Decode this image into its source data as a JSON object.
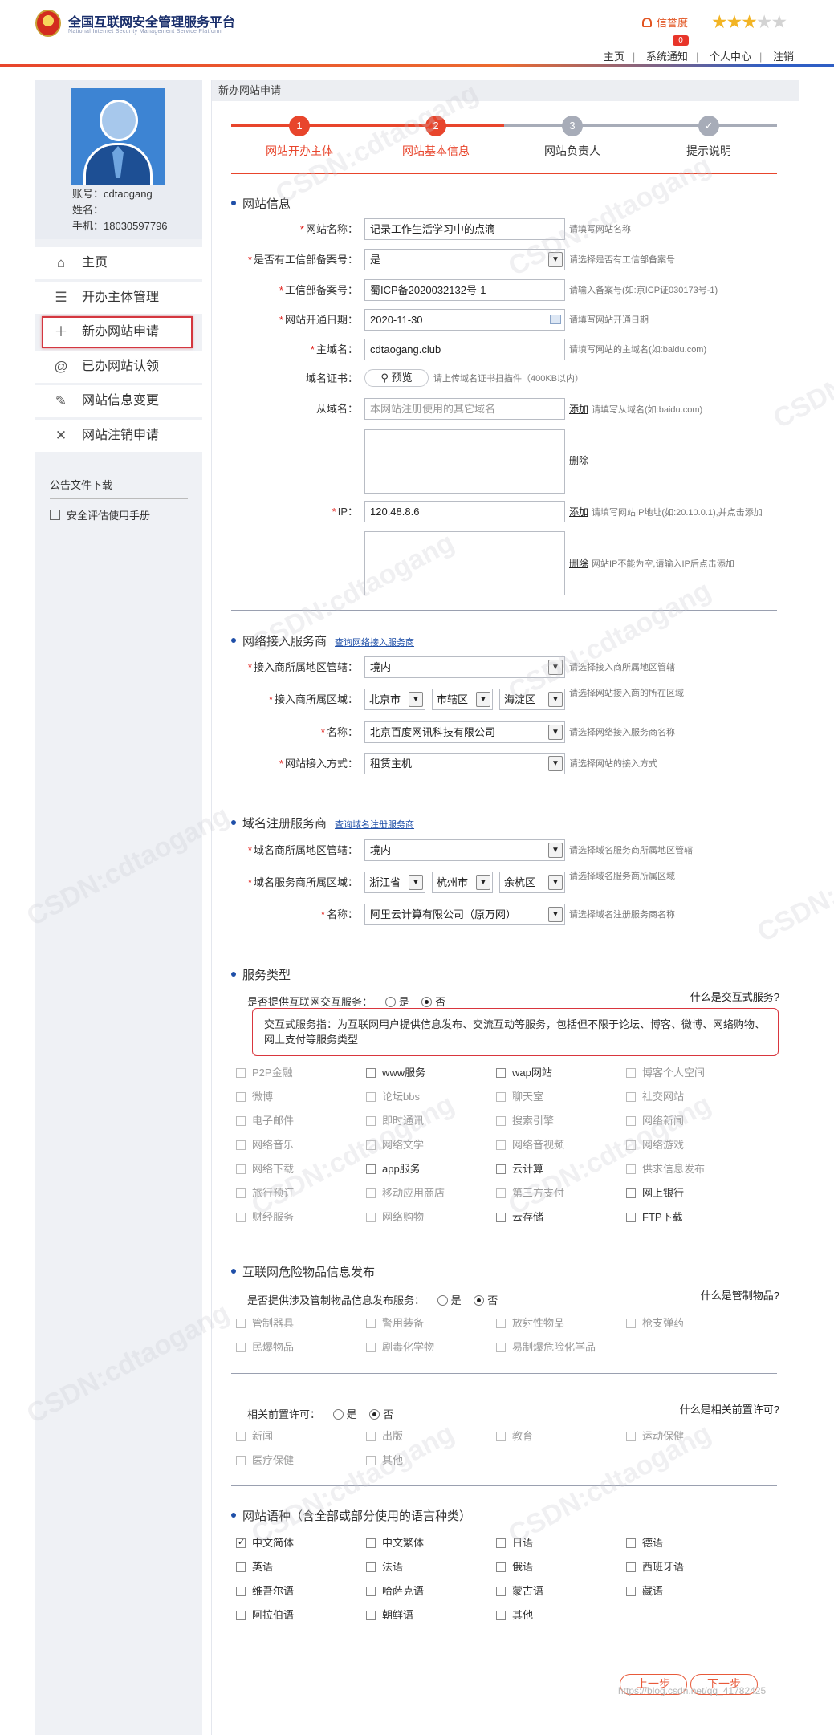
{
  "header": {
    "title": "全国互联网安全管理服务平台",
    "subtitle": "National Internet Security Management Service Platform",
    "credit_label": "信誉度",
    "notice_count": "0",
    "nav": [
      "主页",
      "系统通知",
      "个人中心",
      "注销"
    ],
    "rating": 3
  },
  "sidebar": {
    "account": "账号：cdtaogang",
    "name": "姓名：",
    "phone": "手机：18030597796",
    "menu": [
      {
        "label": "主页",
        "icon": "home-icon"
      },
      {
        "label": "开办主体管理",
        "icon": "list-icon"
      },
      {
        "label": "新办网站申请",
        "icon": "plus-icon"
      },
      {
        "label": "已办网站认领",
        "icon": "at-icon"
      },
      {
        "label": "网站信息变更",
        "icon": "edit-icon"
      },
      {
        "label": "网站注销申请",
        "icon": "close-icon"
      }
    ],
    "docs_title": "公告文件下载",
    "doc_link": "安全评估使用手册"
  },
  "main": {
    "breadcrumb": "新办网站申请",
    "steps": [
      {
        "num": "1",
        "label": "网站开办主体"
      },
      {
        "num": "2",
        "label": "网站基本信息"
      },
      {
        "num": "3",
        "label": "网站负责人"
      },
      {
        "num": "✓",
        "label": "提示说明"
      }
    ],
    "site_info": {
      "title": "网站信息",
      "name_label": "网站名称：",
      "name_value": "记录工作生活学习中的点滴",
      "name_hint": "请填写网站名称",
      "icp_q_label": "是否有工信部备案号：",
      "icp_q_value": "是",
      "icp_q_hint": "请选择是否有工信部备案号",
      "icp_label": "工信部备案号：",
      "icp_value": "蜀ICP备2020032132号-1",
      "icp_hint": "请输入备案号(如:京ICP证030173号-1)",
      "date_label": "网站开通日期：",
      "date_value": "2020-11-30",
      "date_hint": "请填写网站开通日期",
      "domain_label": "主域名：",
      "domain_value": "cdtaogang.club",
      "domain_hint": "请填写网站的主域名(如:baidu.com)",
      "cert_label": "域名证书：",
      "cert_btn": "预览",
      "cert_hint": "请上传域名证书扫描件（400KB以内）",
      "sub_label": "从域名：",
      "sub_placeholder": "本网站注册使用的其它域名",
      "sub_add": "添加",
      "sub_hint": "请填写从域名(如:baidu.com)",
      "sub_del": "删除",
      "ip_label": "IP：",
      "ip_value": "120.48.8.6",
      "ip_add": "添加",
      "ip_hint": "请填写网站IP地址(如:20.10.0.1),并点击添加",
      "ip_del": "删除",
      "ip_del_hint": "网站IP不能为空,请输入IP后点击添加"
    },
    "isp": {
      "title": "网络接入服务商",
      "link": "查询网络接入服务商",
      "area_label": "接入商所属地区管辖：",
      "area_value": "境内",
      "area_hint": "请选择接入商所属地区管辖",
      "region_label": "接入商所属区域：",
      "region_values": [
        "北京市",
        "市辖区",
        "海淀区"
      ],
      "region_hint": "请选择网站接入商的所在区域",
      "name_label": "名称：",
      "name_value": "北京百度网讯科技有限公司",
      "name_hint": "请选择网络接入服务商名称",
      "mode_label": "网站接入方式：",
      "mode_value": "租赁主机",
      "mode_hint": "请选择网站的接入方式"
    },
    "registrar": {
      "title": "域名注册服务商",
      "link": "查询域名注册服务商",
      "area_label": "域名商所属地区管辖：",
      "area_value": "境内",
      "area_hint": "请选择域名服务商所属地区管辖",
      "region_label": "域名服务商所属区域：",
      "region_values": [
        "浙江省",
        "杭州市",
        "余杭区"
      ],
      "region_hint": "请选择域名服务商所属区域",
      "name_label": "名称：",
      "name_value": "阿里云计算有限公司（原万网）",
      "name_hint": "请选择域名注册服务商名称"
    },
    "service": {
      "title": "服务类型",
      "question": "是否提供互联网交互服务：",
      "yes": "是",
      "no": "否",
      "help": "什么是交互式服务?",
      "note": "交互式服务指：为互联网用户提供信息发布、交流互动等服务，包括但不限于论坛、博客、微博、网络购物、网上支付等服务类型",
      "items": [
        {
          "label": "P2P金融",
          "dim": true
        },
        {
          "label": "www服务",
          "dim": false
        },
        {
          "label": "wap网站",
          "dim": false
        },
        {
          "label": "博客个人空间",
          "dim": true
        },
        {
          "label": "微博",
          "dim": true
        },
        {
          "label": "论坛bbs",
          "dim": true
        },
        {
          "label": "聊天室",
          "dim": true
        },
        {
          "label": "社交网站",
          "dim": true
        },
        {
          "label": "电子邮件",
          "dim": true
        },
        {
          "label": "即时通讯",
          "dim": true
        },
        {
          "label": "搜索引擎",
          "dim": true
        },
        {
          "label": "网络新闻",
          "dim": true
        },
        {
          "label": "网络音乐",
          "dim": true
        },
        {
          "label": "网络文学",
          "dim": true
        },
        {
          "label": "网络音视频",
          "dim": true
        },
        {
          "label": "网络游戏",
          "dim": true
        },
        {
          "label": "网络下载",
          "dim": true
        },
        {
          "label": "app服务",
          "dim": false
        },
        {
          "label": "云计算",
          "dim": false
        },
        {
          "label": "供求信息发布",
          "dim": true
        },
        {
          "label": "旅行预订",
          "dim": true
        },
        {
          "label": "移动应用商店",
          "dim": true
        },
        {
          "label": "第三方支付",
          "dim": true
        },
        {
          "label": "网上银行",
          "dim": false
        },
        {
          "label": "财经服务",
          "dim": true
        },
        {
          "label": "网络购物",
          "dim": true
        },
        {
          "label": "云存储",
          "dim": false
        },
        {
          "label": "FTP下载",
          "dim": false
        }
      ]
    },
    "danger": {
      "title": "互联网危险物品信息发布",
      "question": "是否提供涉及管制物品信息发布服务：",
      "yes": "是",
      "no": "否",
      "help": "什么是管制物品?",
      "items": [
        "管制器具",
        "警用装备",
        "放射性物品",
        "枪支弹药",
        "民爆物品",
        "剧毒化学物",
        "易制爆危险化学品"
      ]
    },
    "permit": {
      "question": "相关前置许可：",
      "yes": "是",
      "no": "否",
      "help": "什么是相关前置许可?",
      "items": [
        "新闻",
        "出版",
        "教育",
        "运动保健",
        "医疗保健",
        "其他"
      ]
    },
    "lang": {
      "title": "网站语种（含全部或部分使用的语言种类）",
      "items": [
        {
          "label": "中文简体",
          "checked": true
        },
        {
          "label": "中文繁体",
          "checked": false
        },
        {
          "label": "日语",
          "checked": false
        },
        {
          "label": "德语",
          "checked": false
        },
        {
          "label": "英语",
          "checked": false
        },
        {
          "label": "法语",
          "checked": false
        },
        {
          "label": "俄语",
          "checked": false
        },
        {
          "label": "西班牙语",
          "checked": false
        },
        {
          "label": "维吾尔语",
          "checked": false
        },
        {
          "label": "哈萨克语",
          "checked": false
        },
        {
          "label": "蒙古语",
          "checked": false
        },
        {
          "label": "藏语",
          "checked": false
        },
        {
          "label": "阿拉伯语",
          "checked": false
        },
        {
          "label": "朝鲜语",
          "checked": false
        },
        {
          "label": "其他",
          "checked": false
        }
      ]
    },
    "prev_btn": "上一步",
    "next_btn": "下一步"
  },
  "watermark": "CSDN:cdtaogang",
  "footer_watermark": "https://blog.csdn.net/qq_41782425",
  "colors": {
    "accent": "#e8452c",
    "blue": "#1f4fa8",
    "step_inactive": "#a7acb8"
  }
}
